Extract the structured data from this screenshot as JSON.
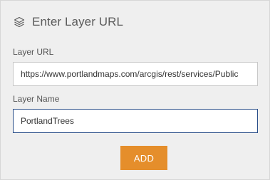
{
  "header": {
    "icon": "layers-icon",
    "title": "Enter Layer URL"
  },
  "layer_url": {
    "label": "Layer URL",
    "value": "https://www.portlandmaps.com/arcgis/rest/services/Public"
  },
  "layer_name": {
    "label": "Layer Name",
    "value": "PortlandTrees"
  },
  "add_button": {
    "label": "ADD",
    "color": "#e58e2b"
  },
  "colors": {
    "panel_background": "#efefef",
    "focus_border": "#2b4f8a"
  }
}
